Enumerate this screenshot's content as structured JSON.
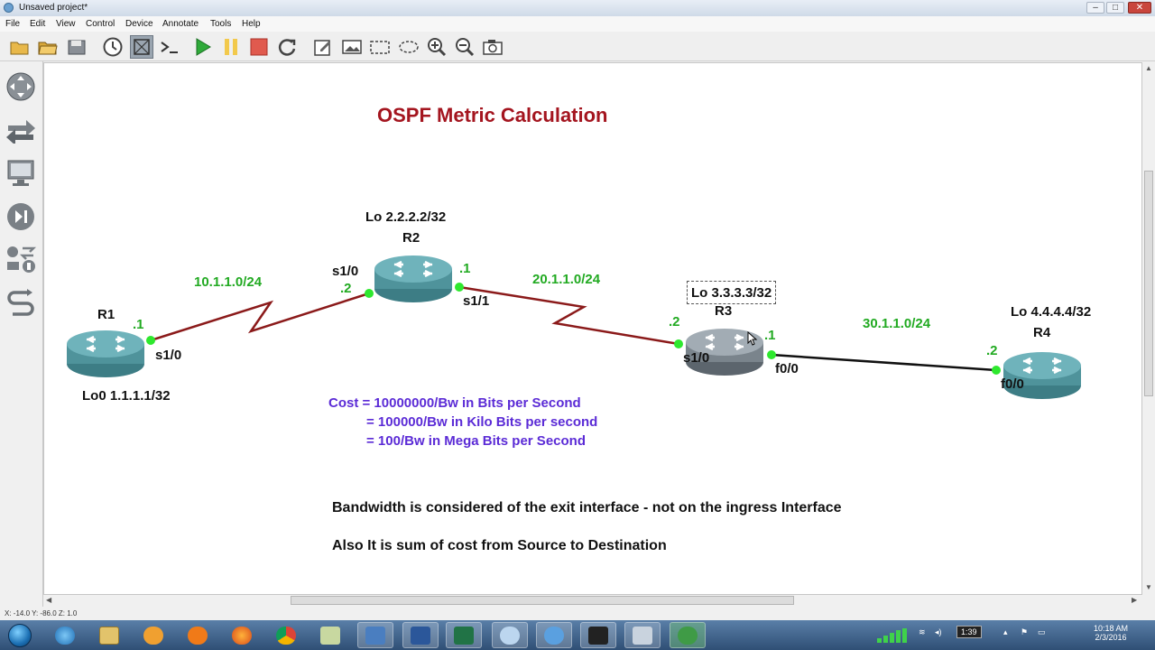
{
  "window": {
    "title": "Unsaved project*",
    "controls": [
      "–",
      "□",
      "✕"
    ]
  },
  "menu": [
    "File",
    "Edit",
    "View",
    "Control",
    "Device",
    "Annotate",
    "Tools",
    "Help"
  ],
  "toolbar": {
    "buttons": [
      "new-project",
      "open-project",
      "save-project",
      "snapshot",
      "toggle-interfaces",
      "console-all",
      "start-all",
      "suspend-all",
      "stop-all",
      "reload-all",
      "add-note",
      "insert-image",
      "draw-rectangle",
      "draw-ellipse",
      "zoom-in",
      "zoom-out",
      "screenshot"
    ]
  },
  "dock": [
    "browse-all-devices",
    "add-link",
    "end-devices",
    "pause-capture",
    "security-devices",
    "connect"
  ],
  "canvas": {
    "title": "OSPF Metric Calculation",
    "routers": {
      "r1": {
        "name": "R1",
        "loopback": "Lo0 1.1.1.1/32",
        "ip": ".1",
        "iface": "s1/0"
      },
      "r2": {
        "name": "R2",
        "loopback": "Lo 2.2.2.2/32",
        "ip_left": ".2",
        "iface_left": "s1/0",
        "ip_right": ".1",
        "iface_right": "s1/1"
      },
      "r3": {
        "name": "R3",
        "loopback": "Lo 3.3.3.3/32",
        "ip_left": ".2",
        "iface_left": "s1/0",
        "ip_right": ".1",
        "iface_right": "f0/0"
      },
      "r4": {
        "name": "R4",
        "loopback": "Lo 4.4.4.4/32",
        "ip": ".2",
        "iface": "f0/0"
      }
    },
    "networks": {
      "n1": "10.1.1.0/24",
      "n2": "20.1.1.0/24",
      "n3": "30.1.1.0/24"
    },
    "cost": {
      "line1": "Cost = 10000000/Bw in Bits per Second",
      "line2": "= 100000/Bw in Kilo Bits per second",
      "line3": "= 100/Bw in Mega Bits per Second"
    },
    "note1": "Bandwidth is considered of the exit interface - not on the ingress Interface",
    "note2": "Also It is sum of cost from Source to Destination"
  },
  "statusbar": {
    "coords": "X: -14.0 Y: -86.0 Z: 1.0"
  },
  "taskbar": {
    "apps": [
      "internet-explorer",
      "file-explorer",
      "media-player",
      "vlc",
      "firefox",
      "chrome",
      "folder",
      "vm-manager",
      "word",
      "excel",
      "search",
      "putty",
      "terminal",
      "calculator",
      "gns3"
    ],
    "tray_badge": "1:39",
    "clock_time": "10:18 AM",
    "clock_date": "2/3/2016"
  },
  "colors": {
    "serial_link": "#8b1a1a",
    "ethernet_link": "#111111",
    "port_dot": "#2ee82e",
    "title": "#a4151f",
    "ip_label": "#22aa22",
    "formula": "#5b2bd6"
  }
}
